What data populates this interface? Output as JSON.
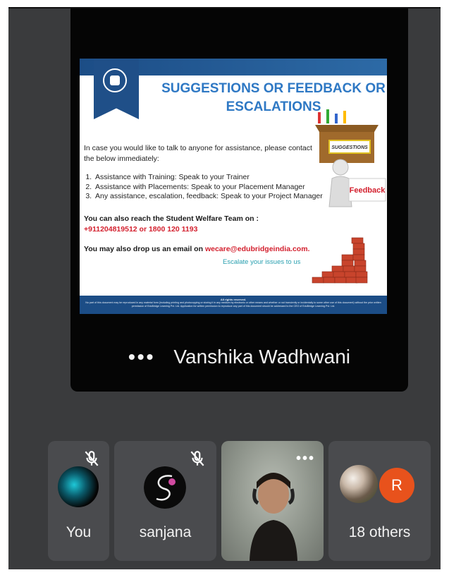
{
  "slide": {
    "title": "SUGGESTIONS OR FEEDBACK OR ESCALATIONS",
    "intro": "In case you would like to talk to anyone for assistance, please contact the below immediately:",
    "list": [
      "Assistance with Training: Speak to your Trainer",
      "Assistance with Placements: Speak to your Placement Manager",
      "Any assistance, escalation, feedback: Speak to your Project Manager"
    ],
    "welfare_prefix": "You can also reach the Student Welfare Team on : ",
    "welfare_numbers": "+911204819512 or 1800 120 1193",
    "email_prefix": "You may also drop us an email on ",
    "email": "wecare@edubridgeindia.com.",
    "escalate": "Escalate your issues to us",
    "box_label": "SUGGESTIONS",
    "feedback_label": "Feedback",
    "footer_head": "All rights reserved.",
    "footer_text": "No part of this document may be reproduced in any material form (including printing and photocopying or storing it in any medium by electronic or other means and whether or not transiently or incidentally to some other use of this document) without the prior written permission of EduBridge Learning Pvt. Ltd. Application for written permission to reproduce any part of this document should be addressed to the CEO of EduBridge Learning Pvt. Ltd."
  },
  "presenter": {
    "more_glyph": "•••",
    "name": "Vanshika Wadhwani"
  },
  "participants": {
    "you_label": "You",
    "sanjana_label": "sanjana",
    "video_more_glyph": "•••",
    "others_label": "18 others",
    "others_initial": "R"
  },
  "colors": {
    "background": "#3a3b3d",
    "tile": "#4a4b4e",
    "slide_blue": "#1c4d86",
    "slide_title": "#2e78c4",
    "accent_red": "#d3202e",
    "avatar_orange": "#e8521c"
  },
  "icons": [
    "mic-off-icon",
    "more-vert-icon"
  ]
}
